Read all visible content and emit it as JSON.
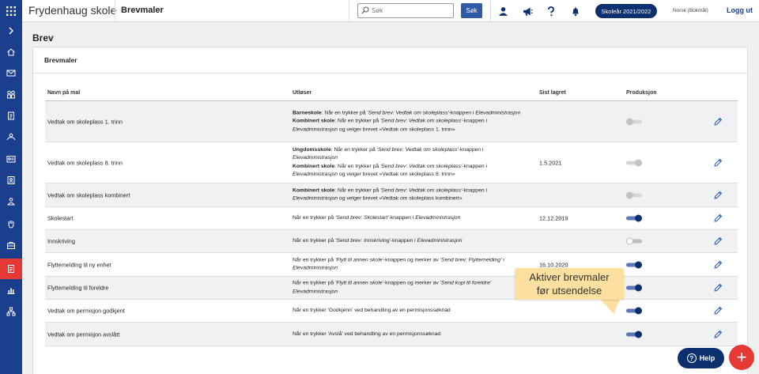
{
  "app": {
    "title": "Frydenhaug skole",
    "section": "Brevmaler"
  },
  "search": {
    "placeholder": "Søk",
    "button_label": "Søk"
  },
  "topbar": {
    "year_label": "Skoleår 2021/2022",
    "language": "Norsk (Bokmål)",
    "logout": "Logg ut"
  },
  "page": {
    "title": "Brev",
    "card_title": "Brevmaler"
  },
  "table": {
    "headers": {
      "name": "Navn på mal",
      "trigger": "Utløser",
      "last_saved": "Sist lagret",
      "production": "Produksjon"
    },
    "rows": [
      {
        "name": "Vedtak om skoleplass 1. trinn",
        "trigger_lines": [
          {
            "b": "Barneskole",
            "t1": ": Når en trykker på ",
            "i1": "'Send brev: Vedtak om skoleplass'",
            "t2": "-knappen i ",
            "i2": "Elevadministrasjon",
            "t3": ""
          },
          {
            "b": "Kombinert skole",
            "t1": ": Når en trykker på ",
            "i1": "'Send brev: Vedtak om skoleplass'",
            "t2": "-knappen i ",
            "i2": "Elevadministrasjon",
            "t3": " og velger brevet «Vedtak om skoleplass 1. trinn»"
          }
        ],
        "last_saved": "",
        "production": "disabled-off"
      },
      {
        "name": "Vedtak om skoleplass 8. trinn",
        "trigger_lines": [
          {
            "b": "Ungdomsskole",
            "t1": ": Når en trykker på ",
            "i1": "'Send brev: Vedtak om skoleplass'",
            "t2": "-knappen i ",
            "i2": "Elevadministrasjon",
            "t3": ""
          },
          {
            "b": "Kombinert skole",
            "t1": ": Når en trykker på ",
            "i1": "'Send brev: Vedtak om skoleplass'",
            "t2": "-knappen i ",
            "i2": "Elevadministrasjon",
            "t3": " og velger brevet «Vedtak om skoleplass 8. trinn»"
          }
        ],
        "last_saved": "1.5.2021",
        "production": "disabled-on"
      },
      {
        "name": "Vedtak om skoleplass kombinert",
        "trigger_lines": [
          {
            "b": "Kombinert skole",
            "t1": ": Når en trykker på ",
            "i1": "'Send brev: Vedtak om skoleplass'",
            "t2": "-knappen i ",
            "i2": "Elevadministrasjon",
            "t3": " og velger brevet «Vedtak om skoleplass kombinert»"
          }
        ],
        "last_saved": "",
        "production": "disabled-off"
      },
      {
        "name": "Skolestart",
        "trigger_lines": [
          {
            "b": "",
            "t1": "Når en trykker på ",
            "i1": "'Send brev: Skolestart'",
            "t2": "-knappen i ",
            "i2": "Elevadministrasjon",
            "t3": ""
          }
        ],
        "last_saved": "12.12.2019",
        "production": "on"
      },
      {
        "name": "Innskriving",
        "trigger_lines": [
          {
            "b": "",
            "t1": "Når en trykker på ",
            "i1": "'Send brev: Innskriving'",
            "t2": "-knappen i ",
            "i2": "Elevadministrasjon",
            "t3": ""
          }
        ],
        "last_saved": "",
        "production": "off"
      },
      {
        "name": "Flyttemelding til ny enhet",
        "trigger_lines": [
          {
            "b": "",
            "t1": "Når en trykker på ",
            "i1": "'Flytt til annen skole'",
            "t2": "-knappen og merker av ",
            "i2": "'Send brev: Flyttemelding'",
            "t3": " i"
          },
          {
            "b": "",
            "t1": "",
            "i1": "Elevadministrasjon",
            "t2": "",
            "i2": "",
            "t3": ""
          }
        ],
        "last_saved": "16.10.2020",
        "production": "on"
      },
      {
        "name": "Flyttemelding til foreldre",
        "trigger_lines": [
          {
            "b": "",
            "t1": "Når en trykker på ",
            "i1": "'Flytt til annen skole'",
            "t2": "-knappen og merker av ",
            "i2": "'Send kopi til foreldre'",
            "t3": ""
          },
          {
            "b": "",
            "t1": "",
            "i1": "Elevadministrasjon",
            "t2": "",
            "i2": "",
            "t3": ""
          }
        ],
        "last_saved": "",
        "production": "on"
      },
      {
        "name": "Vedtak om permisjon godkjent",
        "trigger_lines": [
          {
            "b": "",
            "t1": "Når en trykker 'Godkjenn' ved behandling av en permisjonssøknad",
            "i1": "",
            "t2": "",
            "i2": "",
            "t3": ""
          }
        ],
        "last_saved": "",
        "production": "on"
      },
      {
        "name": "Vedtak om permisjon avslått",
        "trigger_lines": [
          {
            "b": "",
            "t1": "Når en trykker 'Avslå' ved behandling av en permisjonssøknad",
            "i1": "",
            "t2": "",
            "i2": "",
            "t3": ""
          }
        ],
        "last_saved": "",
        "production": "on"
      }
    ]
  },
  "tooltip": {
    "line1": "Aktiver brevmaler",
    "line2": "før utsendelse"
  },
  "help": {
    "label": "Help"
  },
  "fab": {
    "label": "+"
  },
  "colors": {
    "sidebar": "#1b3f8c",
    "accent_red": "#e53935",
    "navy": "#0c2f6e",
    "tooltip": "#fde0a0"
  },
  "sidebar_icons": [
    "grid-icon",
    "chevron-right-icon",
    "home-icon",
    "mail-icon",
    "users-icon",
    "clipboard-icon",
    "group-icon",
    "id-card-icon",
    "contacts-icon",
    "person-upload-icon",
    "hand-icon",
    "briefcase-icon",
    "letter-document-icon",
    "chart-icon",
    "org-icon"
  ]
}
